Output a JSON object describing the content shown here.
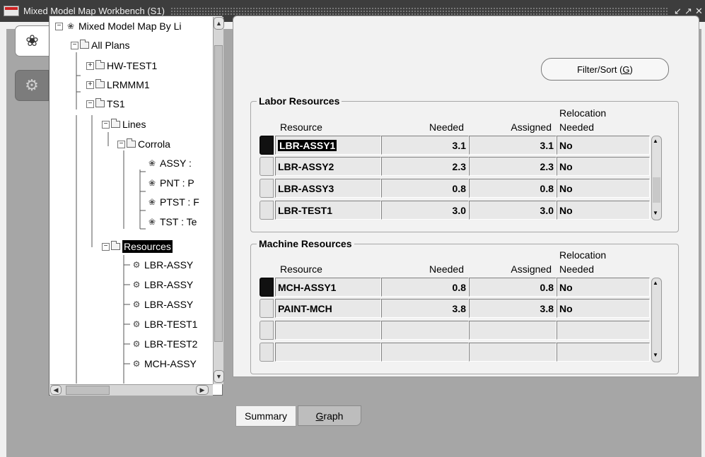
{
  "window": {
    "title": "Mixed Model Map Workbench (S1)",
    "controls": [
      "↙",
      "↗",
      "✕"
    ]
  },
  "side_tabs": {
    "active_icon": "model-map-icon",
    "inactive_icon": "gears-icon"
  },
  "tree": {
    "root": "Mixed Model Map By Li",
    "all_plans": "All Plans",
    "plan1": "HW-TEST1",
    "plan2": "LRMMM1",
    "plan3": "TS1",
    "lines": "Lines",
    "line1": "Corrola",
    "op1": "ASSY :",
    "op2": "PNT : P",
    "op3": "PTST : F",
    "op4": "TST : Te",
    "resources": "Resources",
    "res1": "LBR-ASSY",
    "res2": "LBR-ASSY",
    "res3": "LBR-ASSY",
    "res4": "LBR-TEST1",
    "res5": "LBR-TEST2",
    "res6": "MCH-ASSY"
  },
  "filter_button": {
    "prefix": "Filter/Sort (",
    "mnemonic": "G",
    "suffix": ")"
  },
  "labor": {
    "title": "Labor Resources",
    "headers": {
      "resource": "Resource",
      "needed": "Needed",
      "assigned": "Assigned",
      "relocation_1": "Relocation",
      "relocation_2": "Needed"
    },
    "rows": [
      {
        "resource": "LBR-ASSY1",
        "needed": "3.1",
        "assigned": "3.1",
        "relocation": "No"
      },
      {
        "resource": "LBR-ASSY2",
        "needed": "2.3",
        "assigned": "2.3",
        "relocation": "No"
      },
      {
        "resource": "LBR-ASSY3",
        "needed": "0.8",
        "assigned": "0.8",
        "relocation": "No"
      },
      {
        "resource": "LBR-TEST1",
        "needed": "3.0",
        "assigned": "3.0",
        "relocation": "No"
      }
    ]
  },
  "machine": {
    "title": "Machine Resources",
    "headers": {
      "resource": "Resource",
      "needed": "Needed",
      "assigned": "Assigned",
      "relocation_1": "Relocation",
      "relocation_2": "Needed"
    },
    "rows": [
      {
        "resource": "MCH-ASSY1",
        "needed": "0.8",
        "assigned": "0.8",
        "relocation": "No"
      },
      {
        "resource": "PAINT-MCH",
        "needed": "3.8",
        "assigned": "3.8",
        "relocation": "No"
      },
      {
        "resource": "",
        "needed": "",
        "assigned": "",
        "relocation": ""
      },
      {
        "resource": "",
        "needed": "",
        "assigned": "",
        "relocation": ""
      }
    ]
  },
  "tabs": {
    "summary": "Summary",
    "graph_mnemonic": "G",
    "graph_rest": "raph"
  }
}
